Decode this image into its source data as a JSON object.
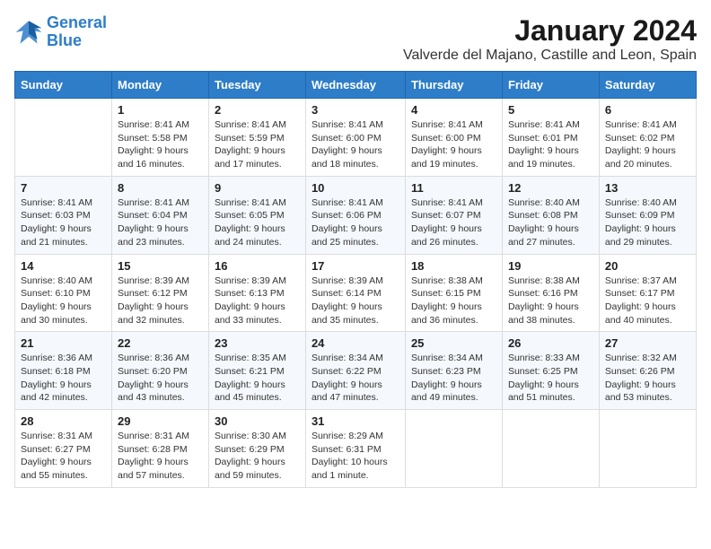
{
  "logo": {
    "line1": "General",
    "line2": "Blue"
  },
  "title": "January 2024",
  "subtitle": "Valverde del Majano, Castille and Leon, Spain",
  "days_header": [
    "Sunday",
    "Monday",
    "Tuesday",
    "Wednesday",
    "Thursday",
    "Friday",
    "Saturday"
  ],
  "weeks": [
    [
      {
        "day": "",
        "info": ""
      },
      {
        "day": "1",
        "info": "Sunrise: 8:41 AM\nSunset: 5:58 PM\nDaylight: 9 hours\nand 16 minutes."
      },
      {
        "day": "2",
        "info": "Sunrise: 8:41 AM\nSunset: 5:59 PM\nDaylight: 9 hours\nand 17 minutes."
      },
      {
        "day": "3",
        "info": "Sunrise: 8:41 AM\nSunset: 6:00 PM\nDaylight: 9 hours\nand 18 minutes."
      },
      {
        "day": "4",
        "info": "Sunrise: 8:41 AM\nSunset: 6:00 PM\nDaylight: 9 hours\nand 19 minutes."
      },
      {
        "day": "5",
        "info": "Sunrise: 8:41 AM\nSunset: 6:01 PM\nDaylight: 9 hours\nand 19 minutes."
      },
      {
        "day": "6",
        "info": "Sunrise: 8:41 AM\nSunset: 6:02 PM\nDaylight: 9 hours\nand 20 minutes."
      }
    ],
    [
      {
        "day": "7",
        "info": "Sunrise: 8:41 AM\nSunset: 6:03 PM\nDaylight: 9 hours\nand 21 minutes."
      },
      {
        "day": "8",
        "info": "Sunrise: 8:41 AM\nSunset: 6:04 PM\nDaylight: 9 hours\nand 23 minutes."
      },
      {
        "day": "9",
        "info": "Sunrise: 8:41 AM\nSunset: 6:05 PM\nDaylight: 9 hours\nand 24 minutes."
      },
      {
        "day": "10",
        "info": "Sunrise: 8:41 AM\nSunset: 6:06 PM\nDaylight: 9 hours\nand 25 minutes."
      },
      {
        "day": "11",
        "info": "Sunrise: 8:41 AM\nSunset: 6:07 PM\nDaylight: 9 hours\nand 26 minutes."
      },
      {
        "day": "12",
        "info": "Sunrise: 8:40 AM\nSunset: 6:08 PM\nDaylight: 9 hours\nand 27 minutes."
      },
      {
        "day": "13",
        "info": "Sunrise: 8:40 AM\nSunset: 6:09 PM\nDaylight: 9 hours\nand 29 minutes."
      }
    ],
    [
      {
        "day": "14",
        "info": "Sunrise: 8:40 AM\nSunset: 6:10 PM\nDaylight: 9 hours\nand 30 minutes."
      },
      {
        "day": "15",
        "info": "Sunrise: 8:39 AM\nSunset: 6:12 PM\nDaylight: 9 hours\nand 32 minutes."
      },
      {
        "day": "16",
        "info": "Sunrise: 8:39 AM\nSunset: 6:13 PM\nDaylight: 9 hours\nand 33 minutes."
      },
      {
        "day": "17",
        "info": "Sunrise: 8:39 AM\nSunset: 6:14 PM\nDaylight: 9 hours\nand 35 minutes."
      },
      {
        "day": "18",
        "info": "Sunrise: 8:38 AM\nSunset: 6:15 PM\nDaylight: 9 hours\nand 36 minutes."
      },
      {
        "day": "19",
        "info": "Sunrise: 8:38 AM\nSunset: 6:16 PM\nDaylight: 9 hours\nand 38 minutes."
      },
      {
        "day": "20",
        "info": "Sunrise: 8:37 AM\nSunset: 6:17 PM\nDaylight: 9 hours\nand 40 minutes."
      }
    ],
    [
      {
        "day": "21",
        "info": "Sunrise: 8:36 AM\nSunset: 6:18 PM\nDaylight: 9 hours\nand 42 minutes."
      },
      {
        "day": "22",
        "info": "Sunrise: 8:36 AM\nSunset: 6:20 PM\nDaylight: 9 hours\nand 43 minutes."
      },
      {
        "day": "23",
        "info": "Sunrise: 8:35 AM\nSunset: 6:21 PM\nDaylight: 9 hours\nand 45 minutes."
      },
      {
        "day": "24",
        "info": "Sunrise: 8:34 AM\nSunset: 6:22 PM\nDaylight: 9 hours\nand 47 minutes."
      },
      {
        "day": "25",
        "info": "Sunrise: 8:34 AM\nSunset: 6:23 PM\nDaylight: 9 hours\nand 49 minutes."
      },
      {
        "day": "26",
        "info": "Sunrise: 8:33 AM\nSunset: 6:25 PM\nDaylight: 9 hours\nand 51 minutes."
      },
      {
        "day": "27",
        "info": "Sunrise: 8:32 AM\nSunset: 6:26 PM\nDaylight: 9 hours\nand 53 minutes."
      }
    ],
    [
      {
        "day": "28",
        "info": "Sunrise: 8:31 AM\nSunset: 6:27 PM\nDaylight: 9 hours\nand 55 minutes."
      },
      {
        "day": "29",
        "info": "Sunrise: 8:31 AM\nSunset: 6:28 PM\nDaylight: 9 hours\nand 57 minutes."
      },
      {
        "day": "30",
        "info": "Sunrise: 8:30 AM\nSunset: 6:29 PM\nDaylight: 9 hours\nand 59 minutes."
      },
      {
        "day": "31",
        "info": "Sunrise: 8:29 AM\nSunset: 6:31 PM\nDaylight: 10 hours\nand 1 minute."
      },
      {
        "day": "",
        "info": ""
      },
      {
        "day": "",
        "info": ""
      },
      {
        "day": "",
        "info": ""
      }
    ]
  ]
}
